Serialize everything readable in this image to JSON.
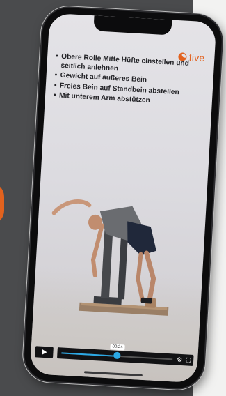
{
  "brand": {
    "logo_text": "five",
    "accent_color": "#e2621e"
  },
  "instructions": [
    "Obere Rolle Mitte Hüfte einstellen und seitlich anlehnen",
    "Gewicht auf äußeres Bein",
    "Freies Bein auf Standbein abstellen",
    "Mit unterem Arm abstützen"
  ],
  "player": {
    "play_icon": "play-icon",
    "current_time": "00:24",
    "progress": 0.5,
    "progress_color": "#2ba9e6",
    "settings_icon": "gear-icon",
    "fullscreen_icon": "fullscreen-icon"
  }
}
